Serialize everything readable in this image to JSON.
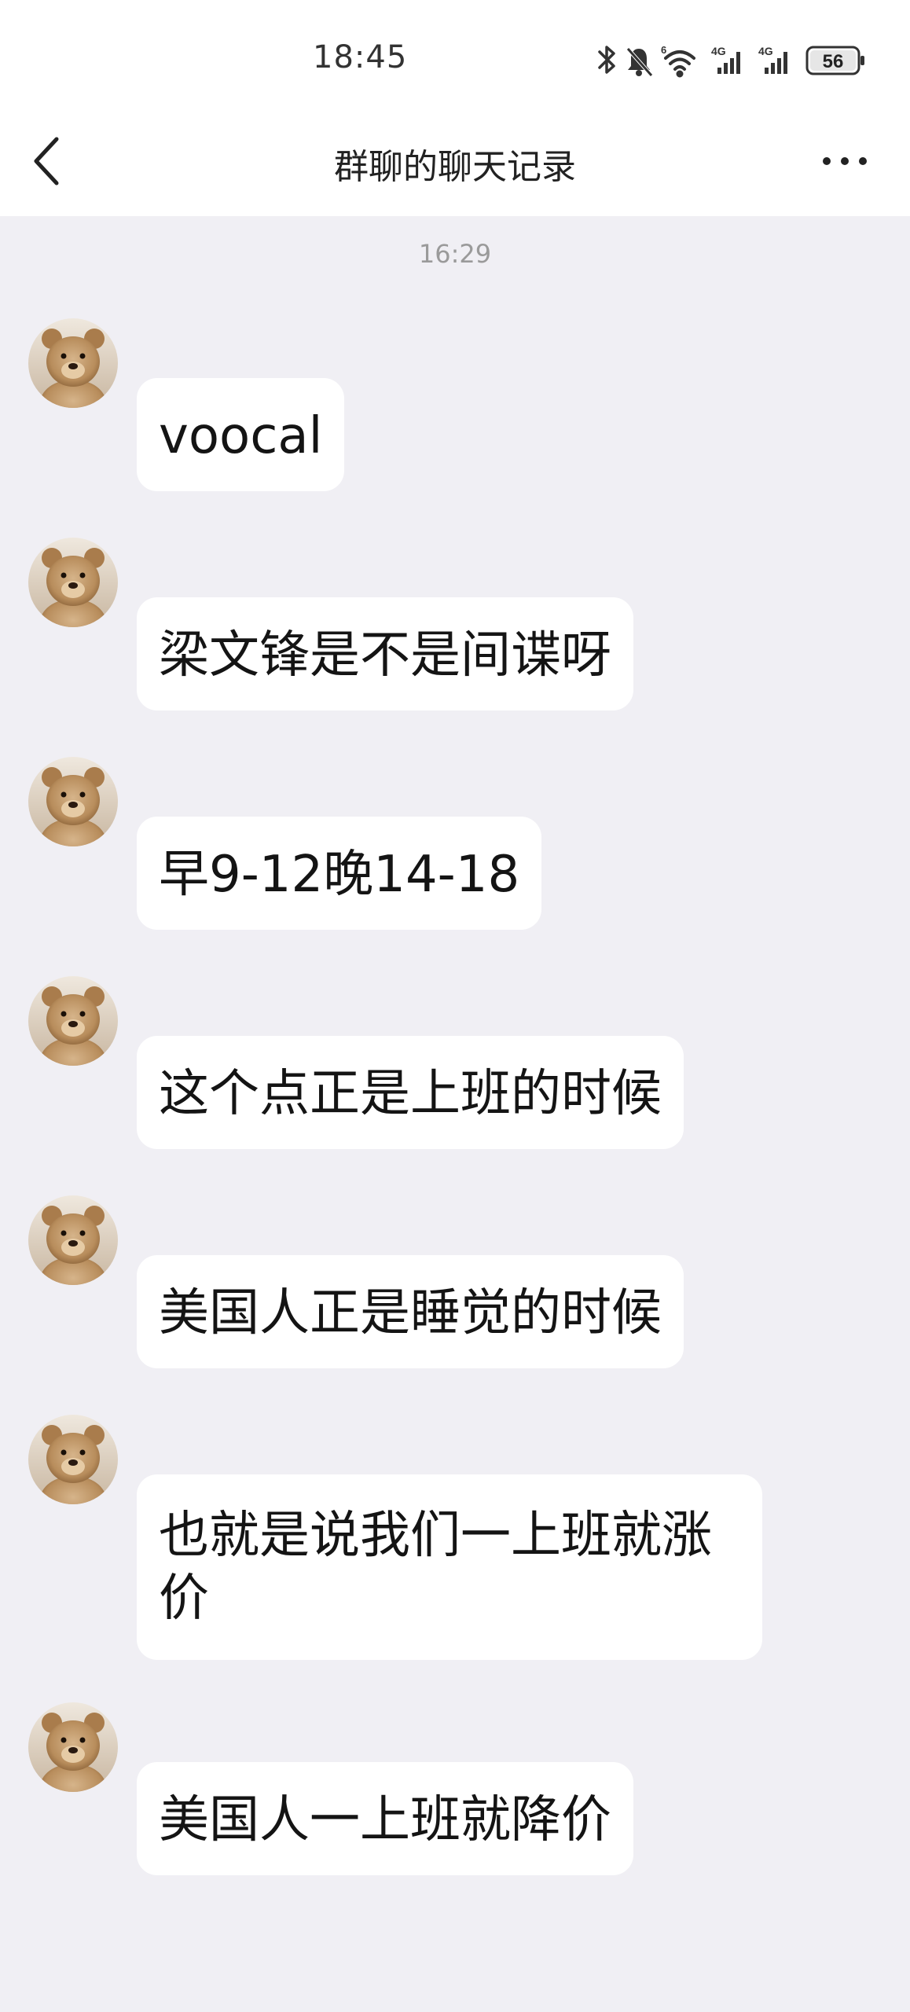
{
  "status_bar": {
    "time": "18:45",
    "battery": "56",
    "network_labels": [
      "6",
      "4G",
      "4G"
    ],
    "icons": [
      "bluetooth-icon",
      "mute-icon",
      "wifi-icon",
      "signal-icon",
      "signal-icon",
      "battery-icon"
    ]
  },
  "header": {
    "title": "群聊的聊天记录",
    "back_icon": "chevron-left-icon",
    "more_icon": "more-icon"
  },
  "chat": {
    "time_divider": "16:29",
    "messages": [
      {
        "text": "voocal"
      },
      {
        "text": "梁文锋是不是间谍呀"
      },
      {
        "text": "早9-12晚14-18"
      },
      {
        "text": "这个点正是上班的时候"
      },
      {
        "text": "美国人正是睡觉的时候"
      },
      {
        "text": "也就是说我们一上班就涨价"
      },
      {
        "text": "美国人一上班就降价"
      }
    ]
  },
  "colors": {
    "background": "#f0eff4",
    "bubble": "#ffffff",
    "header": "#ffffff",
    "divider_text": "#9a9a9a"
  }
}
